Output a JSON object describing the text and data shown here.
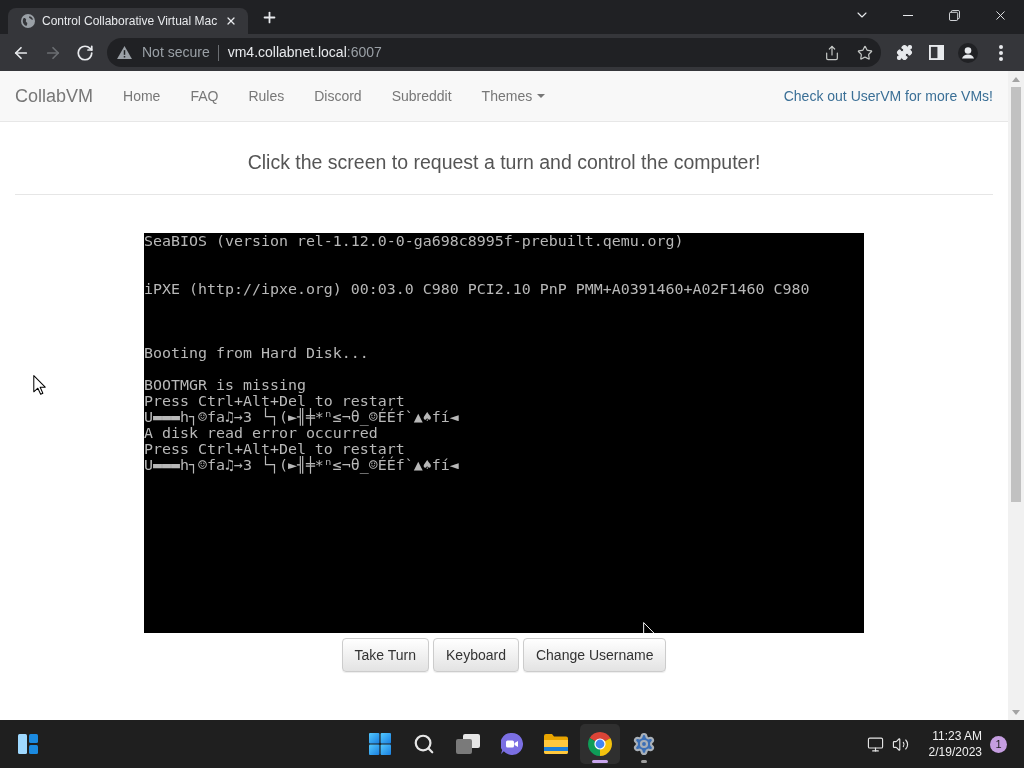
{
  "browser": {
    "tabs": [
      {
        "title": "Control Collaborative Virtual Mac",
        "selected": true
      }
    ],
    "nav_buttons": [
      {
        "kind": "back",
        "disabled": false
      },
      {
        "kind": "forward",
        "disabled": true
      },
      {
        "kind": "reload",
        "disabled": false
      }
    ],
    "address_bar": {
      "security_label": "Not secure",
      "host": "vm4.collabnet.local",
      "port": ":6007"
    }
  },
  "navbar": {
    "brand": "CollabVM",
    "links": [
      {
        "label": "Home",
        "dropdown": false
      },
      {
        "label": "FAQ",
        "dropdown": false
      },
      {
        "label": "Rules",
        "dropdown": false
      },
      {
        "label": "Discord",
        "dropdown": false
      },
      {
        "label": "Subreddit",
        "dropdown": false
      },
      {
        "label": "Themes",
        "dropdown": true
      }
    ],
    "promo_link": "Check out UserVM for more VMs!"
  },
  "heading": "Click the screen to request a turn and control the computer!",
  "vm_screen": {
    "blocks": [
      [
        "SeaBIOS (version rel-1.12.0-0-ga698c8995f-prebuilt.qemu.org)"
      ],
      [
        "iPXE (http://ipxe.org) 00:03.0 C980 PCI2.10 PnP PMM+A0391460+A02F1460 C980"
      ],
      [
        "Booting from Hard Disk..."
      ],
      [
        "BOOTMGR is missing",
        "Press Ctrl+Alt+Del to restart",
        "U▬▬▬h┐☺fa♫→3 └┐(►╢╪*ⁿ≤¬θ_☺ÉÉf`▲♠fí◄",
        "A disk read error occurred",
        "Press Ctrl+Alt+Del to restart",
        "U▬▬▬h┐☺fa♫→3 └┐(►╢╪*ⁿ≤¬θ_☺ÉÉf`▲♠fí◄"
      ]
    ]
  },
  "vm_buttons": [
    "Take Turn",
    "Keyboard",
    "Change Username"
  ],
  "taskbar": {
    "apps": [
      {
        "kind": "start",
        "open": false,
        "focused": false
      },
      {
        "kind": "search",
        "open": false,
        "focused": false
      },
      {
        "kind": "taskview",
        "open": false,
        "focused": false
      },
      {
        "kind": "chat",
        "open": false,
        "focused": false
      },
      {
        "kind": "files",
        "open": false,
        "focused": false
      },
      {
        "kind": "browser",
        "open": true,
        "focused": true
      },
      {
        "kind": "settings",
        "open": true,
        "focused": false
      }
    ],
    "clock": {
      "time": "11:23 AM",
      "date": "2/19/2023"
    },
    "notification_count": "1"
  }
}
